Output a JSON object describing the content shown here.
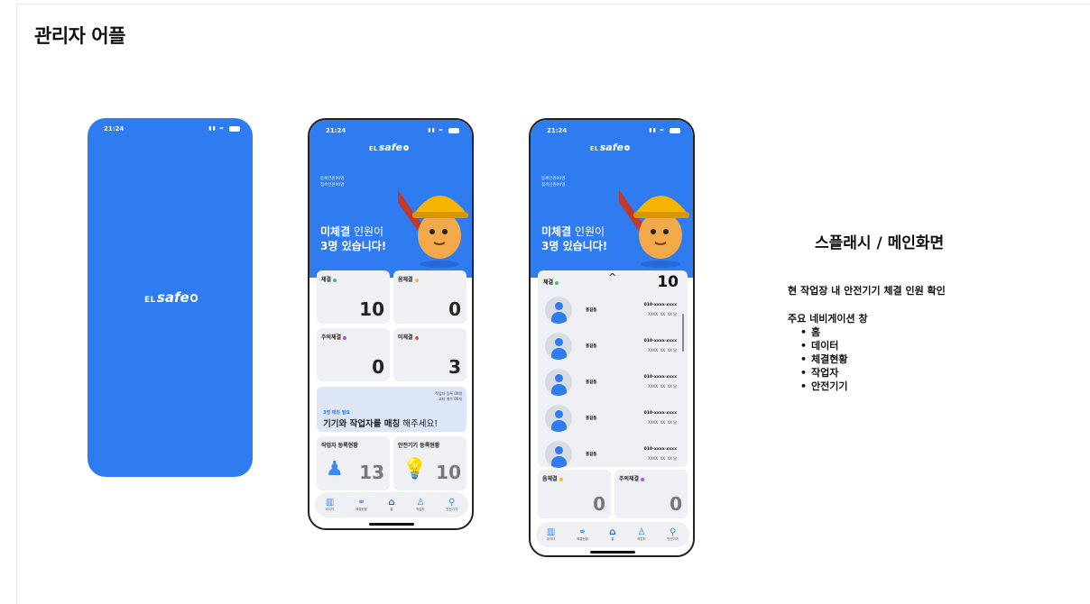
{
  "page_title": "관리자 어플",
  "status_time": "21:24",
  "logo": {
    "prefix": "EL",
    "word": "safe"
  },
  "splash": {},
  "main": {
    "registered_lines": [
      "등록인원00명",
      "접속인원00명"
    ],
    "headline_bold": "미체결",
    "headline_rest": " 인원이",
    "headline_line2": "3명 있습니다!",
    "cards": [
      {
        "label": "체결",
        "value": "10",
        "dot_color": "#3fc25a"
      },
      {
        "label": "음체결",
        "value": "0",
        "dot_color": "#f5b82e"
      },
      {
        "label": "주의체결",
        "value": "0",
        "dot_color": "#b04fd8"
      },
      {
        "label": "미체결",
        "value": "3",
        "dot_color": "#e84545"
      }
    ],
    "promo": {
      "meta_line1": "작업자 등록 00명",
      "meta_line2": "고지 개수  00개",
      "sub": "3명 매칭 필요",
      "main_bold": "기기와 작업자를 매칭",
      "main_rest": " 해주세요!"
    },
    "reg_cards": [
      {
        "label": "작업자 등록현황",
        "value": "13",
        "icon": "worker-icon"
      },
      {
        "label": "안전기기 등록현황",
        "value": "10",
        "icon": "bulb-icon"
      }
    ]
  },
  "tabs": [
    {
      "label": "데이터",
      "icon": "chart-icon"
    },
    {
      "label": "체결현황",
      "icon": "link-icon"
    },
    {
      "label": "홈",
      "icon": "home-icon"
    },
    {
      "label": "작업자",
      "icon": "user-icon"
    },
    {
      "label": "안전기기",
      "icon": "bulb-icon"
    }
  ],
  "list": {
    "label": "체결",
    "count": "10",
    "rows": [
      {
        "name": "홍길동",
        "phone": "010-xxxx-xxxx",
        "date": "XXXX. XX. XX 날"
      },
      {
        "name": "홍길동",
        "phone": "010-xxxx-xxxx",
        "date": "XXXX. XX. XX 날"
      },
      {
        "name": "홍길동",
        "phone": "010-xxxx-xxxx",
        "date": "XXXX. XX. XX 날"
      },
      {
        "name": "홍길동",
        "phone": "010-xxxx-xxxx",
        "date": "XXXX. XX. XX 날"
      },
      {
        "name": "홍길동",
        "phone": "010-xxxx-xxxx",
        "date": "XXXX. XX. XX 날"
      }
    ],
    "bottom_cards": [
      {
        "label": "음체결",
        "value": "0",
        "dot_color": "#f5b82e"
      },
      {
        "label": "주의체결",
        "value": "0",
        "dot_color": "#b04fd8"
      }
    ]
  },
  "description": {
    "title": "스플래시 / 메인화면",
    "line": "현 작업장 내 안전기기 체결 인원 확인",
    "nav_title": "주요 네비게이션 창",
    "nav_items": [
      "홈",
      "데이터",
      "체결현황",
      "작업자",
      "안전기기"
    ]
  }
}
